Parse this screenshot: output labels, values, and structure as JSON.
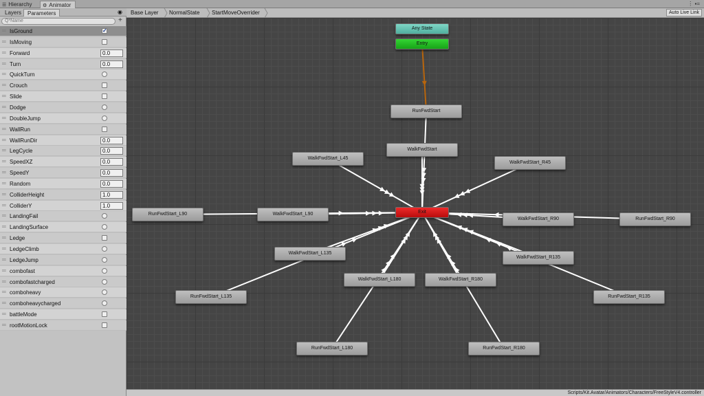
{
  "window_tabs": [
    {
      "label": "Hierarchy",
      "icon": "hierarchy-icon",
      "active": false
    },
    {
      "label": "Animator",
      "icon": "animator-icon",
      "active": true
    }
  ],
  "left_panel": {
    "tabs": [
      {
        "label": "Layers",
        "active": false
      },
      {
        "label": "Parameters",
        "active": true
      }
    ],
    "search_placeholder": "Q*Name",
    "parameters": [
      {
        "name": "IsGround",
        "type": "bool",
        "value": true
      },
      {
        "name": "IsMoving",
        "type": "bool",
        "value": false
      },
      {
        "name": "Forward",
        "type": "float",
        "value": "0.0"
      },
      {
        "name": "Turn",
        "type": "float",
        "value": "0.0"
      },
      {
        "name": "QuickTurn",
        "type": "trigger"
      },
      {
        "name": "Crouch",
        "type": "bool",
        "value": false
      },
      {
        "name": "Slide",
        "type": "bool",
        "value": false
      },
      {
        "name": "Dodge",
        "type": "trigger"
      },
      {
        "name": "DoubleJump",
        "type": "trigger"
      },
      {
        "name": "WallRun",
        "type": "bool",
        "value": false
      },
      {
        "name": "WallRunDir",
        "type": "float",
        "value": "0.0"
      },
      {
        "name": "LegCycle",
        "type": "float",
        "value": "0.0"
      },
      {
        "name": "SpeedXZ",
        "type": "float",
        "value": "0.0"
      },
      {
        "name": "SpeedY",
        "type": "float",
        "value": "0.0"
      },
      {
        "name": "Random",
        "type": "float",
        "value": "0.0"
      },
      {
        "name": "ColliderHeight",
        "type": "float",
        "value": "1.0"
      },
      {
        "name": "ColliderY",
        "type": "float",
        "value": "1.0"
      },
      {
        "name": "LandingFail",
        "type": "trigger"
      },
      {
        "name": "LandingSurface",
        "type": "trigger"
      },
      {
        "name": "Ledge",
        "type": "bool",
        "value": false
      },
      {
        "name": "LedgeClimb",
        "type": "trigger"
      },
      {
        "name": "LedgeJump",
        "type": "trigger"
      },
      {
        "name": "combofast",
        "type": "trigger"
      },
      {
        "name": "combofastcharged",
        "type": "trigger"
      },
      {
        "name": "comboheavy",
        "type": "trigger"
      },
      {
        "name": "comboheavycharged",
        "type": "trigger"
      },
      {
        "name": "battleMode",
        "type": "bool",
        "value": false
      },
      {
        "name": "rootMotionLock",
        "type": "bool",
        "value": false
      }
    ]
  },
  "breadcrumbs": [
    "Base Layer",
    "NormalState",
    "StartMoveOverrider"
  ],
  "auto_live_link": "Auto Live Link",
  "states": [
    {
      "id": "any",
      "label": "Any State",
      "kind": "any"
    },
    {
      "id": "entry",
      "label": "Entry",
      "kind": "entry"
    },
    {
      "id": "exit",
      "label": "Exit",
      "kind": "exit"
    },
    {
      "id": "run",
      "label": "RunFwdStart",
      "kind": "state"
    },
    {
      "id": "walk",
      "label": "WalkFwdStart",
      "kind": "state"
    },
    {
      "id": "wl45",
      "label": "WalkFwdStart_L45",
      "kind": "state"
    },
    {
      "id": "wr45",
      "label": "WalkFwdStart_R45",
      "kind": "state"
    },
    {
      "id": "rl90",
      "label": "RunFwdStart_L90",
      "kind": "state"
    },
    {
      "id": "wl90",
      "label": "WalkFwdStart_L90",
      "kind": "state"
    },
    {
      "id": "wr90",
      "label": "WalkFwdStart_R90",
      "kind": "state"
    },
    {
      "id": "rr90",
      "label": "RunFwdStart_R90",
      "kind": "state"
    },
    {
      "id": "wl135",
      "label": "WalkFwdStart_L135",
      "kind": "state"
    },
    {
      "id": "wr135",
      "label": "WalkFwdStart_R135",
      "kind": "state"
    },
    {
      "id": "rl135",
      "label": "RunFwdStart_L135",
      "kind": "state"
    },
    {
      "id": "rr135",
      "label": "RunFwdStart_R135",
      "kind": "state"
    },
    {
      "id": "wl180",
      "label": "WalkFwdStart_L180",
      "kind": "state"
    },
    {
      "id": "wr180",
      "label": "WalkFwdStart_R180",
      "kind": "state"
    },
    {
      "id": "rl180",
      "label": "RunFwdStart_L180",
      "kind": "state"
    },
    {
      "id": "rr180",
      "label": "RunFwdStart_R180",
      "kind": "state"
    }
  ],
  "transitions": [
    {
      "from": "entry",
      "to": "run",
      "kind": "default"
    },
    {
      "from": "run",
      "to": "exit"
    },
    {
      "from": "walk",
      "to": "exit"
    },
    {
      "from": "wl45",
      "to": "exit"
    },
    {
      "from": "wr45",
      "to": "exit"
    },
    {
      "from": "rl90",
      "to": "exit"
    },
    {
      "from": "wl90",
      "to": "exit"
    },
    {
      "from": "wr90",
      "to": "exit"
    },
    {
      "from": "rr90",
      "to": "exit"
    },
    {
      "from": "wl135",
      "to": "exit"
    },
    {
      "from": "wr135",
      "to": "exit"
    },
    {
      "from": "rl135",
      "to": "exit"
    },
    {
      "from": "rr135",
      "to": "exit"
    },
    {
      "from": "wl180",
      "to": "exit"
    },
    {
      "from": "wr180",
      "to": "exit"
    },
    {
      "from": "rl180",
      "to": "exit"
    },
    {
      "from": "rr180",
      "to": "exit"
    }
  ],
  "status_path": "Scripts/Kit.Avatar/Animators/Characters/FreeStyleV4.controller",
  "colors": {
    "entry": "#22c022",
    "any_state": "#6cc9b8",
    "exit": "#d81818",
    "default_transition": "#b8650c",
    "transition": "#ffffff"
  }
}
